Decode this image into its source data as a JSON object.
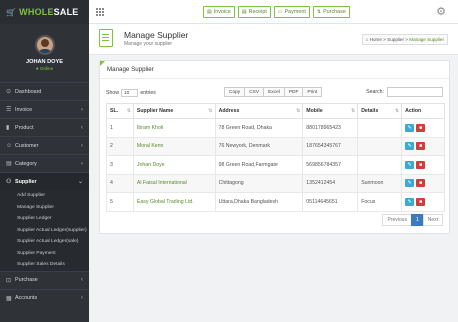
{
  "brand": {
    "name_left": "WHOLE",
    "name_right": "SALE",
    "logo_glyph": "🛒"
  },
  "profile": {
    "name": "JOHAN DOYE",
    "status": "● Online"
  },
  "menu": [
    {
      "icon": "⊙",
      "label": "Dashboard",
      "chevron": ""
    },
    {
      "icon": "☰",
      "label": "Invoice",
      "chevron": "‹"
    },
    {
      "icon": "▮",
      "label": "Product",
      "chevron": "‹"
    },
    {
      "icon": "☺",
      "label": "Customer",
      "chevron": "‹"
    },
    {
      "icon": "▤",
      "label": "Category",
      "chevron": "‹"
    },
    {
      "icon": "⚇",
      "label": "Supplier",
      "chevron": "⌄"
    }
  ],
  "submenu": [
    "Add Supplier",
    "Manage Supplier",
    "Supplier Ledger",
    "Supplier Actual Ledger(supplier)",
    "Supplier Actual Ledger(sale)",
    "Supplier Payment",
    "Supplier Sales Details"
  ],
  "menu_bottom": [
    {
      "icon": "⊡",
      "label": "Purchase",
      "chevron": "‹"
    },
    {
      "icon": "▦",
      "label": "Accounts",
      "chevron": "‹"
    }
  ],
  "topbar": {
    "buttons": [
      {
        "icon": "▤",
        "label": "Invoice"
      },
      {
        "icon": "▤",
        "label": "Receipt"
      },
      {
        "icon": "▭",
        "label": "Payment"
      },
      {
        "icon": "⇅",
        "label": "Purchase"
      }
    ],
    "gear_icon": "⚙"
  },
  "header": {
    "title": "Manage Supplier",
    "subtitle": "Manage your supplier",
    "crumbs": [
      "⌂ Home",
      "Supplier",
      "Manage Supplier"
    ]
  },
  "card": {
    "title": "Manage Supplier",
    "show_label": "Show",
    "show_value": "10",
    "entries_label": "entries",
    "export_buttons": [
      "Copy",
      "CSV",
      "Excel",
      "PDF",
      "Print"
    ],
    "search_label": "Search:",
    "columns": [
      "SL.",
      "Supplier Name",
      "Address",
      "Mobile",
      "Details",
      "Action"
    ],
    "rows": [
      {
        "sl": "1",
        "name": "Ibram Kholi",
        "address": "78 Green Road, Dhaka",
        "mobile": "880178965423",
        "details": ""
      },
      {
        "sl": "2",
        "name": "Moral Kenn",
        "address": "76 Newyork, Denmark",
        "mobile": "187654345767",
        "details": ""
      },
      {
        "sl": "3",
        "name": "Johan Doye",
        "address": "98 Green Road,Farmgate",
        "mobile": "569856784357",
        "details": ""
      },
      {
        "sl": "4",
        "name": "Al Faisal International",
        "address": "Chittagong",
        "mobile": "1352412454",
        "details": "Sunmoon"
      },
      {
        "sl": "5",
        "name": "Easy Global Trading Ltd.",
        "address": "Uttara,Dhaka Bangladesh",
        "mobile": "05114645651",
        "details": "Focus"
      }
    ],
    "pager": {
      "prev": "Previous",
      "current": "1",
      "next": "Next"
    }
  }
}
